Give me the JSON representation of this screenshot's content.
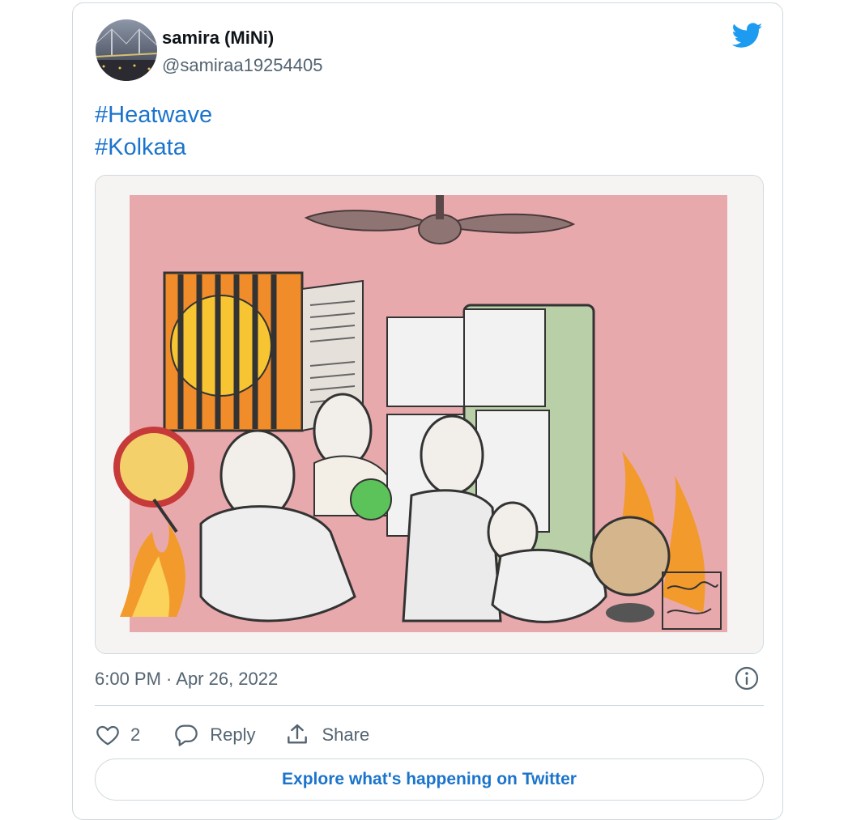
{
  "tweet": {
    "author_name": "samira (MiNi)",
    "author_handle": "@samiraa19254405",
    "hashtags": [
      "#Heatwave",
      "#Kolkata"
    ],
    "timestamp": "6:00 PM · Apr 26, 2022",
    "like_count": "2",
    "reply_label": "Reply",
    "share_label": "Share",
    "explore_label": "Explore what's happening on Twitter"
  },
  "icons": {
    "brand": "twitter-bird-icon",
    "info": "info-icon",
    "like": "heart-icon",
    "reply": "speech-bubble-icon",
    "share": "share-upload-icon"
  },
  "colors": {
    "brand_blue": "#1d9bf0",
    "link_blue": "#1b74cc",
    "muted_text": "#536471",
    "border": "#cfd9de"
  }
}
